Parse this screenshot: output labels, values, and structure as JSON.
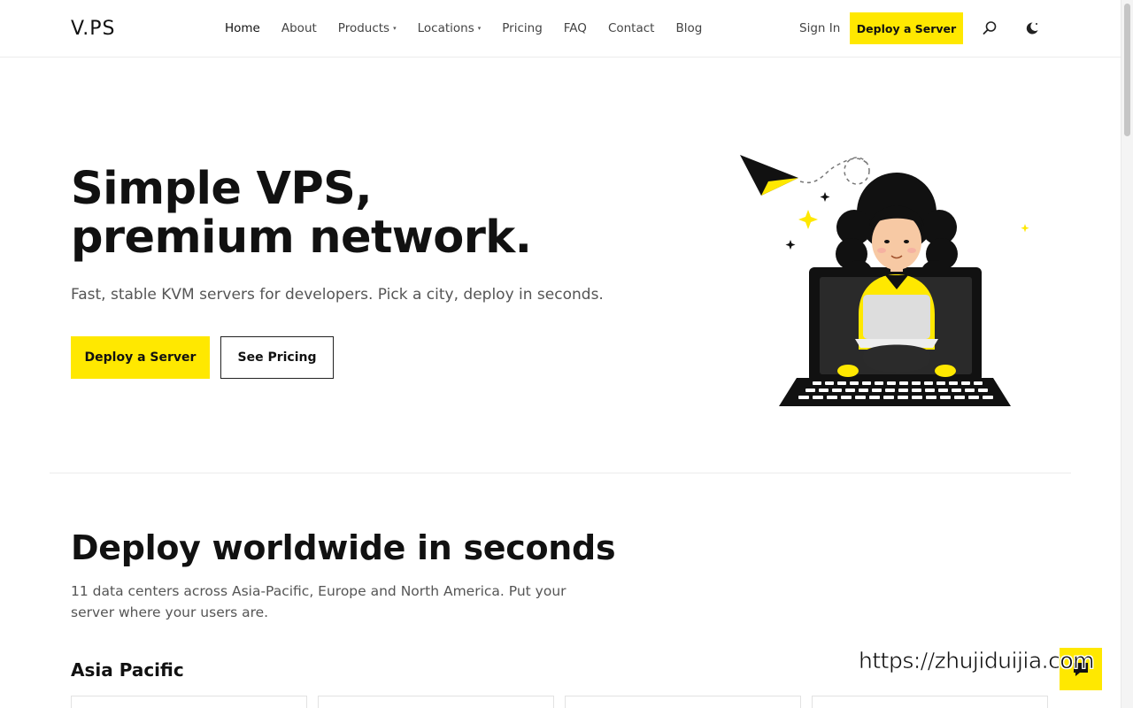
{
  "brand": {
    "logo": "V.PS"
  },
  "nav": {
    "items": [
      {
        "label": "Home",
        "active": true,
        "dropdown": false
      },
      {
        "label": "About",
        "active": false,
        "dropdown": false
      },
      {
        "label": "Products",
        "active": false,
        "dropdown": true
      },
      {
        "label": "Locations",
        "active": false,
        "dropdown": true
      },
      {
        "label": "Pricing",
        "active": false,
        "dropdown": false
      },
      {
        "label": "FAQ",
        "active": false,
        "dropdown": false
      },
      {
        "label": "Contact",
        "active": false,
        "dropdown": false
      },
      {
        "label": "Blog",
        "active": false,
        "dropdown": false
      }
    ],
    "caret": "▾",
    "sign_in": "Sign In",
    "deploy": "Deploy a Server",
    "icons": [
      "search-icon",
      "moon-icon"
    ]
  },
  "hero": {
    "title_line1": "Simple VPS,",
    "title_line2": "premium network.",
    "subtitle": "Fast, stable KVM servers for developers. Pick a city, deploy in seconds.",
    "primary_cta": "Deploy a Server",
    "secondary_cta": "See Pricing"
  },
  "section": {
    "title": "Deploy worldwide in seconds",
    "description": "11 data centers across Asia-Pacific, Europe and North America. Put your server where your users are.",
    "region": "Asia Pacific"
  },
  "watermark": "https://zhujiduijia.com",
  "colors": {
    "accent": "#ffe800",
    "text": "#111111",
    "muted": "#555555",
    "border": "#ececec"
  }
}
